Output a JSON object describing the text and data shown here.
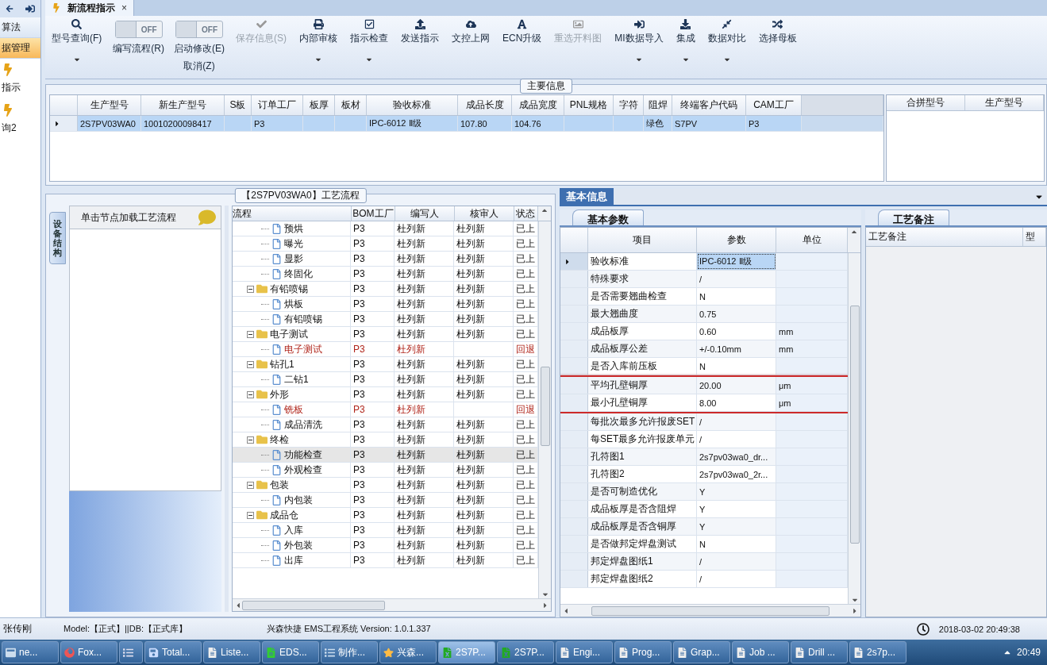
{
  "sidebar": {
    "items": [
      {
        "label": "算法",
        "kind": "plain",
        "selected": false
      },
      {
        "label": "据管理",
        "kind": "plain",
        "selected": true
      },
      {
        "label": "指示",
        "kind": "icon",
        "selected": false
      },
      {
        "label": "询2",
        "kind": "icon",
        "selected": false
      }
    ]
  },
  "tab": {
    "label": "新流程指示",
    "close": "×",
    "selected": true
  },
  "toolbar": [
    {
      "kind": "button",
      "label": "型号查询(F)",
      "disabled": false,
      "dropdown": true
    },
    {
      "kind": "toggle",
      "toggle_text": "OFF",
      "on": false,
      "label": "编写流程(R)"
    },
    {
      "kind": "toggle",
      "toggle_text": "OFF",
      "on": false,
      "label": "启动修改(E)",
      "sublabel": "取消(Z)"
    },
    {
      "kind": "button",
      "label": "保存信息(S)",
      "disabled": true,
      "dropdown": false
    },
    {
      "kind": "button",
      "label": "内部审核",
      "disabled": false,
      "dropdown": true
    },
    {
      "kind": "button",
      "label": "指示检查",
      "disabled": false,
      "dropdown": true
    },
    {
      "kind": "button",
      "label": "发送指示",
      "disabled": false,
      "dropdown": false
    },
    {
      "kind": "button",
      "label": "文控上网",
      "disabled": false,
      "dropdown": false
    },
    {
      "kind": "button",
      "label": "ECN升级",
      "disabled": false,
      "dropdown": false
    },
    {
      "kind": "button",
      "label": "重选开料图",
      "disabled": true,
      "dropdown": false
    },
    {
      "kind": "button",
      "label": "MI数据导入",
      "disabled": false,
      "dropdown": true
    },
    {
      "kind": "button",
      "label": "集成",
      "disabled": false,
      "dropdown": true
    },
    {
      "kind": "button",
      "label": "数据对比",
      "disabled": false,
      "dropdown": true
    },
    {
      "kind": "button",
      "label": "选择母板",
      "disabled": false,
      "dropdown": false
    }
  ],
  "main_info": {
    "title": "主要信息",
    "columns": [
      "生产型号",
      "新生产型号",
      "S板",
      "订单工厂",
      "板厚",
      "板材",
      "验收标准",
      "成品长度",
      "成品宽度",
      "PNL规格",
      "字符",
      "阻焊",
      "终端客户代码",
      "CAM工厂"
    ],
    "rows": [
      {
        "selected": true,
        "cells": [
          "2S7PV03WA0",
          "10010200098417",
          null,
          "P3",
          null,
          null,
          "IPC-6012 Ⅱ级",
          "107.80",
          "104.76",
          null,
          null,
          "绿色",
          "S7PV",
          "P3"
        ]
      }
    ],
    "merge_columns": [
      "合拼型号",
      "生产型号"
    ]
  },
  "flow": {
    "title": "【2S7PV03WA0】工艺流程",
    "side_tab": "设备结构",
    "node_hint": "单击节点加载工艺流程",
    "columns": [
      "流程",
      "BOM工厂",
      "编写人",
      "核审人",
      "状态"
    ],
    "nodes": [
      {
        "kind": "hidden_parent",
        "children": [
          {
            "kind": "step",
            "label": "预烘",
            "factory": "P3",
            "writer": "杜列新",
            "reviewer": "杜列新",
            "status": "已上",
            "returned": false,
            "selected": false
          },
          {
            "kind": "step",
            "label": "曝光",
            "factory": "P3",
            "writer": "杜列新",
            "reviewer": "杜列新",
            "status": "已上",
            "returned": false,
            "selected": false
          },
          {
            "kind": "step",
            "label": "显影",
            "factory": "P3",
            "writer": "杜列新",
            "reviewer": "杜列新",
            "status": "已上",
            "returned": false,
            "selected": false
          },
          {
            "kind": "step",
            "label": "终固化",
            "factory": "P3",
            "writer": "杜列新",
            "reviewer": "杜列新",
            "status": "已上",
            "returned": false,
            "selected": false
          }
        ]
      },
      {
        "kind": "group",
        "label": "有铅喷锡",
        "expanded": true,
        "factory": "P3",
        "writer": "杜列新",
        "reviewer": "杜列新",
        "status": "已上",
        "returned": false,
        "selected": false,
        "children": [
          {
            "kind": "step",
            "label": "烘板",
            "factory": "P3",
            "writer": "杜列新",
            "reviewer": "杜列新",
            "status": "已上",
            "returned": false,
            "selected": false
          },
          {
            "kind": "step",
            "label": "有铅喷锡",
            "factory": "P3",
            "writer": "杜列新",
            "reviewer": "杜列新",
            "status": "已上",
            "returned": false,
            "selected": false
          }
        ]
      },
      {
        "kind": "group",
        "label": "电子测试",
        "expanded": true,
        "factory": "P3",
        "writer": "杜列新",
        "reviewer": "杜列新",
        "status": "已上",
        "returned": false,
        "selected": false,
        "children": [
          {
            "kind": "step",
            "label": "电子测试",
            "factory": "P3",
            "writer": "杜列新",
            "status": "回退",
            "returned": true,
            "selected": false
          }
        ]
      },
      {
        "kind": "group",
        "label": "钻孔1",
        "expanded": true,
        "factory": "P3",
        "writer": "杜列新",
        "reviewer": "杜列新",
        "status": "已上",
        "returned": false,
        "selected": false,
        "children": [
          {
            "kind": "step",
            "label": "二钻1",
            "factory": "P3",
            "writer": "杜列新",
            "reviewer": "杜列新",
            "status": "已上",
            "returned": false,
            "selected": false
          }
        ]
      },
      {
        "kind": "group",
        "label": "外形",
        "expanded": true,
        "factory": "P3",
        "writer": "杜列新",
        "reviewer": "杜列新",
        "status": "已上",
        "returned": false,
        "selected": false,
        "children": [
          {
            "kind": "step",
            "label": "铣板",
            "factory": "P3",
            "writer": "杜列新",
            "status": "回退",
            "returned": true,
            "selected": false
          },
          {
            "kind": "step",
            "label": "成品清洗",
            "factory": "P3",
            "writer": "杜列新",
            "reviewer": "杜列新",
            "status": "已上",
            "returned": false,
            "selected": false
          }
        ]
      },
      {
        "kind": "group",
        "label": "终检",
        "expanded": true,
        "factory": "P3",
        "writer": "杜列新",
        "reviewer": "杜列新",
        "status": "已上",
        "returned": false,
        "selected": false,
        "children": [
          {
            "kind": "step",
            "label": "功能检查",
            "factory": "P3",
            "writer": "杜列新",
            "reviewer": "杜列新",
            "status": "已上",
            "returned": false,
            "selected": true
          },
          {
            "kind": "step",
            "label": "外观检查",
            "factory": "P3",
            "writer": "杜列新",
            "reviewer": "杜列新",
            "status": "已上",
            "returned": false,
            "selected": false
          }
        ]
      },
      {
        "kind": "group",
        "label": "包装",
        "expanded": true,
        "factory": "P3",
        "writer": "杜列新",
        "reviewer": "杜列新",
        "status": "已上",
        "returned": false,
        "selected": false,
        "children": [
          {
            "kind": "step",
            "label": "内包装",
            "factory": "P3",
            "writer": "杜列新",
            "reviewer": "杜列新",
            "status": "已上",
            "returned": false,
            "selected": false
          }
        ]
      },
      {
        "kind": "group",
        "label": "成品仓",
        "expanded": true,
        "factory": "P3",
        "writer": "杜列新",
        "reviewer": "杜列新",
        "status": "已上",
        "returned": false,
        "selected": false,
        "children": [
          {
            "kind": "step",
            "label": "入库",
            "factory": "P3",
            "writer": "杜列新",
            "reviewer": "杜列新",
            "status": "已上",
            "returned": false,
            "selected": false
          },
          {
            "kind": "step",
            "label": "外包装",
            "factory": "P3",
            "writer": "杜列新",
            "reviewer": "杜列新",
            "status": "已上",
            "returned": false,
            "selected": false
          },
          {
            "kind": "step",
            "label": "出库",
            "factory": "P3",
            "writer": "杜列新",
            "reviewer": "杜列新",
            "status": "已上",
            "returned": false,
            "selected": false
          }
        ]
      }
    ]
  },
  "basic_info": {
    "title": "基本信息",
    "params_tab": "基本参数",
    "notes_tab": "工艺备注",
    "columns": [
      "项目",
      "参数",
      "单位"
    ],
    "rows": [
      {
        "item": "验收标准",
        "value": "IPC-6012 Ⅱ级",
        "selected": true,
        "highlighted": false
      },
      {
        "item": "特殊要求",
        "value": "/",
        "selected": false,
        "highlighted": false
      },
      {
        "item": "是否需要翘曲检查",
        "value": "N",
        "selected": false,
        "highlighted": false
      },
      {
        "item": "最大翘曲度",
        "value": "0.75",
        "selected": false,
        "highlighted": false
      },
      {
        "item": "成品板厚",
        "value": "0.60",
        "unit": "mm",
        "selected": false,
        "highlighted": false
      },
      {
        "item": "成品板厚公差",
        "value": "+/-0.10mm",
        "unit": "mm",
        "selected": false,
        "highlighted": false
      },
      {
        "item": "是否入库前压板",
        "value": "N",
        "selected": false,
        "highlighted": false
      },
      {
        "item": "平均孔壁铜厚",
        "value": "20.00",
        "unit": "μm",
        "selected": false,
        "highlighted": true
      },
      {
        "item": "最小孔壁铜厚",
        "value": "8.00",
        "unit": "μm",
        "selected": false,
        "highlighted": true
      },
      {
        "item": "每批次最多允许报废SET",
        "value": "/",
        "selected": false,
        "highlighted": false
      },
      {
        "item": "每SET最多允许报废单元",
        "value": "/",
        "selected": false,
        "highlighted": false
      },
      {
        "item": "孔符图1",
        "value": "2s7pv03wa0_dr...",
        "selected": false,
        "highlighted": false
      },
      {
        "item": "孔符图2",
        "value": "2s7pv03wa0_2r...",
        "selected": false,
        "highlighted": false
      },
      {
        "item": "是否可制造优化",
        "value": "Y",
        "selected": false,
        "highlighted": false
      },
      {
        "item": "成品板厚是否含阻焊",
        "value": "Y",
        "selected": false,
        "highlighted": false
      },
      {
        "item": "成品板厚是否含铜厚",
        "value": "Y",
        "selected": false,
        "highlighted": false
      },
      {
        "item": "是否做邦定焊盘测试",
        "value": "N",
        "selected": false,
        "highlighted": false
      },
      {
        "item": "邦定焊盘图纸1",
        "value": "/",
        "selected": false,
        "highlighted": false
      },
      {
        "item": "邦定焊盘图纸2",
        "value": "/",
        "selected": false,
        "highlighted": false
      }
    ],
    "notes_columns": [
      "工艺备注",
      "型"
    ]
  },
  "status_bar": {
    "user": "张传刚",
    "model": "Model:【正式】||DB:【正式库】",
    "system": "兴森快捷 EMS工程系统 Version: 1.0.1.337",
    "datetime": "2018-03-02 20:49:38"
  },
  "taskbar": {
    "items": [
      {
        "label": "ne...",
        "selected": false
      },
      {
        "label": "Fox...",
        "selected": false
      },
      {
        "selected": false
      },
      {
        "label": "Total...",
        "selected": false
      },
      {
        "label": "Liste...",
        "selected": false
      },
      {
        "label": "EDS...",
        "selected": false
      },
      {
        "label": "制作...",
        "selected": false
      },
      {
        "label": "兴森...",
        "selected": false
      },
      {
        "label": "2S7P...",
        "selected": true
      },
      {
        "label": "2S7P...",
        "selected": false
      },
      {
        "label": "Engi...",
        "selected": false
      },
      {
        "label": "Prog...",
        "selected": false
      },
      {
        "label": "Grap...",
        "selected": false
      },
      {
        "label": "Job ...",
        "selected": false
      },
      {
        "label": "Drill ...",
        "selected": false
      },
      {
        "label": "2s7p...",
        "selected": false
      }
    ],
    "clock": "20:49"
  }
}
